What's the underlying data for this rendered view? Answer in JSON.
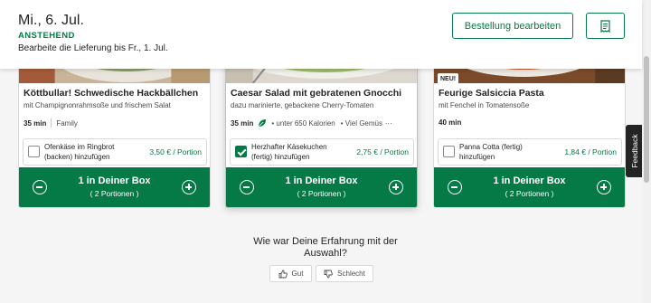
{
  "header": {
    "date": "Mi., 6. Jul.",
    "status": "ANSTEHEND",
    "edit_note": "Bearbeite die Lieferung bis Fr., 1. Jul.",
    "edit_button": "Bestellung bearbeiten",
    "receipt_icon": "receipt-icon"
  },
  "cards": [
    {
      "title": "Köttbullar! Schwedische Hackbällchen",
      "subtitle": "mit Champignonrahmsoße und frischem Salat",
      "time": "35 min",
      "tags": "Family",
      "addon_label": "Ofenkäse im Ringbrot (backen) hinzufügen",
      "addon_price": "3,50 € / Portion",
      "addon_checked": false,
      "qty": "1 in Deiner Box",
      "portions": "( 2 Portionen )"
    },
    {
      "title": "Caesar Salad mit gebratenen Gnocchi",
      "subtitle": "dazu marinierte, gebackene Cherry-Tomaten",
      "time": "35 min",
      "tag_calories": "• unter 650 Kalorien",
      "tag_veg": "• Viel Gemüse",
      "more": "···",
      "addon_label": "Herzhafter Käsekuchen (fertig) hinzufügen",
      "addon_price": "2,75 € / Portion",
      "addon_checked": true,
      "qty": "1 in Deiner Box",
      "portions": "( 2 Portionen )"
    },
    {
      "badge": "NEU!",
      "title": "Feurige Salsiccia Pasta",
      "subtitle": "mit Fenchel in Tomatensoße",
      "time": "40 min",
      "addon_label": "Panna Cotta (fertig) hinzufügen",
      "addon_price": "1,84 € / Portion",
      "addon_checked": false,
      "qty": "1 in Deiner Box",
      "portions": "( 2 Portionen )"
    }
  ],
  "feedback": {
    "question": "Wie war Deine Erfahrung mit der Auswahl?",
    "good": "Gut",
    "bad": "Schlecht",
    "side_tab": "Feedback"
  },
  "colors": {
    "brand_green": "#067a46",
    "text": "#242424"
  }
}
